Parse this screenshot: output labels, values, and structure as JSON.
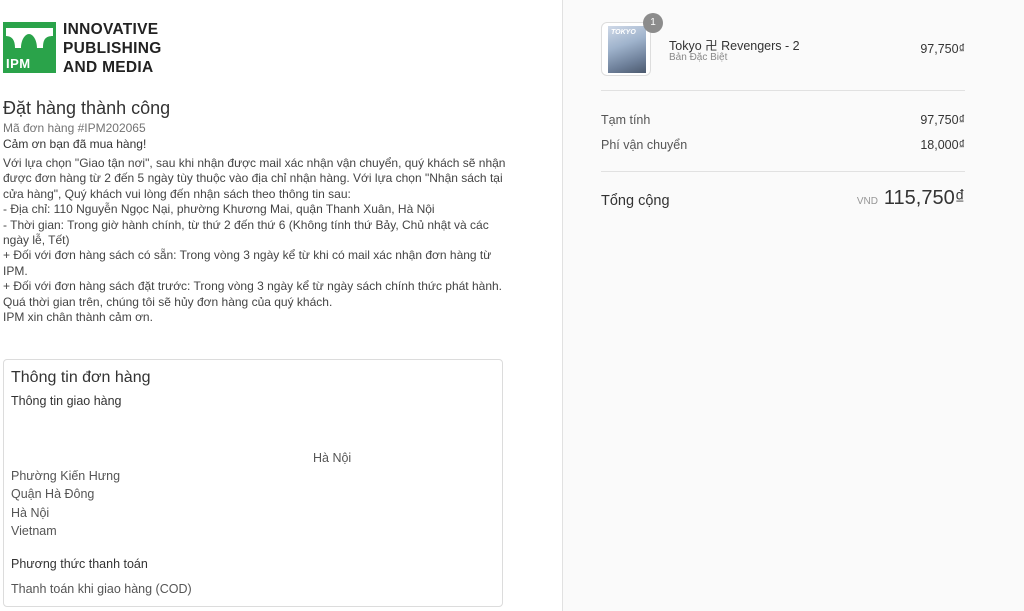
{
  "logo": {
    "mark": "IPM",
    "lines": [
      "INNOVATIVE",
      "PUBLISHING",
      "AND MEDIA"
    ],
    "color": "#2aa34a"
  },
  "confirmation": {
    "title": "Đặt hàng thành công",
    "order_number": "Mã đơn hàng #IPM202065",
    "thanks": "Cảm ơn bạn đã mua hàng!",
    "notice": [
      "Với lựa chọn \"Giao tận nơi\", sau khi nhận được mail xác nhận vận chuyển, quý khách sẽ nhận được đơn hàng từ 2 đến 5 ngày tùy thuộc vào địa chỉ nhận hàng. Với lựa chọn \"Nhận sách tại cửa hàng\", Quý khách vui lòng đến nhận sách theo thông tin sau:",
      "- Địa chỉ: 110 Nguyễn Ngọc Nại, phường Khương Mai, quận Thanh Xuân, Hà Nội",
      "- Thời gian: Trong giờ hành chính, từ thứ 2 đến thứ 6 (Không tính thứ Bảy, Chủ nhật và các ngày lễ, Tết)",
      "+ Đối với đơn hàng sách có sẵn: Trong vòng 3 ngày kể từ khi có mail xác nhận đơn hàng từ IPM.",
      "+ Đối với đơn hàng sách đặt trước: Trong vòng 3 ngày kể từ ngày sách chính thức phát hành.",
      "Quá thời gian trên, chúng tôi sẽ hủy đơn hàng của quý khách.",
      "IPM xin chân thành cảm ơn."
    ]
  },
  "order_info": {
    "title": "Thông tin đơn hàng",
    "shipping_title": "Thông tin giao hàng",
    "address_city_line": "Hà Nội",
    "address_lines": [
      "Phường Kiến Hưng",
      "Quận Hà Đông",
      "Hà Nội",
      "Vietnam"
    ],
    "payment_title": "Phương thức thanh toán",
    "payment_value": "Thanh toán khi giao hàng (COD)"
  },
  "cart": {
    "item": {
      "name": "Tokyo 卍 Revengers - 2",
      "variant": "Bản Đặc Biệt",
      "price": "97,750₫",
      "quantity": "1",
      "cover_text": "TOKYO"
    },
    "subtotal_label": "Tạm tính",
    "subtotal_value": "97,750₫",
    "shipping_label": "Phí vận chuyển",
    "shipping_value": "18,000₫",
    "total_label": "Tổng cộng",
    "currency": "VND",
    "total_value": "115,750₫"
  }
}
